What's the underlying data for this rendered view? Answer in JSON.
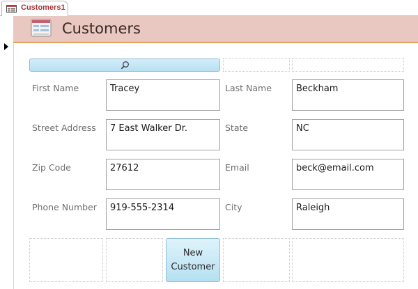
{
  "tab": {
    "label": "Customers1",
    "icon": "form-icon"
  },
  "header": {
    "title": "Customers",
    "icon": "form-icon"
  },
  "search": {
    "icon": "search-icon"
  },
  "fields": {
    "first_name": {
      "label": "First Name",
      "value": "Tracey"
    },
    "last_name": {
      "label": "Last Name",
      "value": "Beckham"
    },
    "street_address": {
      "label": "Street Address",
      "value": "7 East Walker Dr."
    },
    "state": {
      "label": "State",
      "value": "NC"
    },
    "zip_code": {
      "label": "Zip Code",
      "value": "27612"
    },
    "email": {
      "label": "Email",
      "value": "beck@email.com"
    },
    "phone_number": {
      "label": "Phone Number",
      "value": "919-555-2314"
    },
    "city": {
      "label": "City",
      "value": "Raleigh"
    }
  },
  "buttons": {
    "new_customer_line1": "New",
    "new_customer_line2": "Customer"
  },
  "colors": {
    "header_band": "#e8c8c0",
    "header_underline": "#e8a05a",
    "tab_text": "#a4373a",
    "button_fill": "#b5e0f2"
  }
}
